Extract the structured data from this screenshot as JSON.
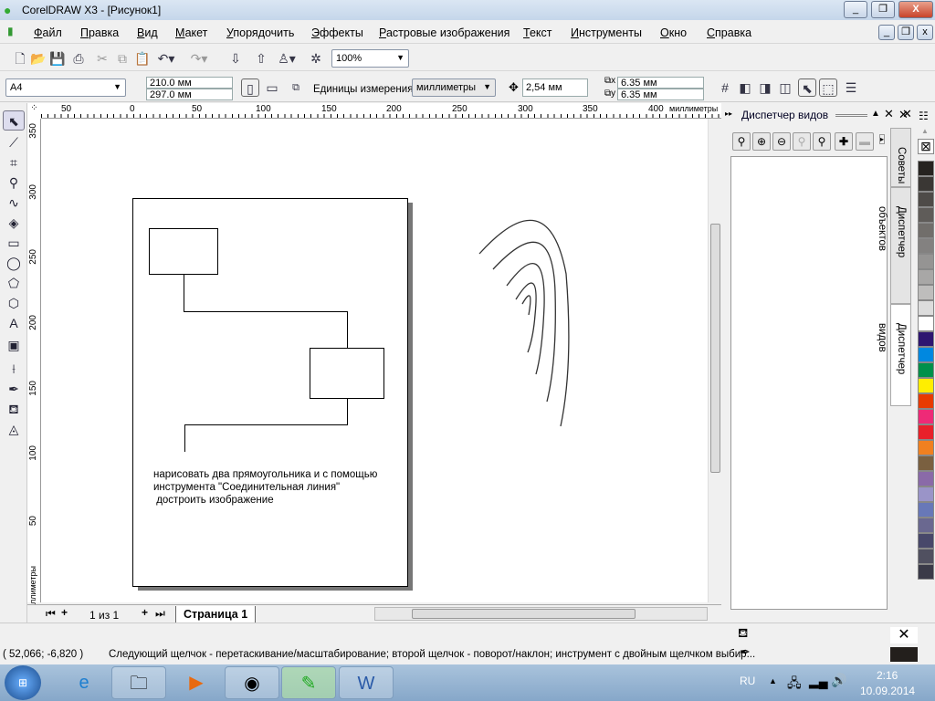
{
  "window": {
    "title": "CorelDRAW X3 - [Рисунок1]",
    "minimize": "_",
    "maximize": "❐",
    "close": "X"
  },
  "menu": [
    "Файл",
    "Правка",
    "Вид",
    "Макет",
    "Упорядочить",
    "Эффекты",
    "Растровые изображения",
    "Текст",
    "Инструменты",
    "Окно",
    "Справка"
  ],
  "toolbar": {
    "zoom": "100%"
  },
  "propbar": {
    "page_size": "A4",
    "width": "210.0 мм",
    "height": "297.0 мм",
    "units_label": "Единицы измерения:",
    "units": "миллиметры",
    "nudge": "2,54 мм",
    "dup_x": "6.35 мм",
    "dup_y": "6.35 мм"
  },
  "ruler": {
    "h_ticks": [
      "50",
      "0",
      "50",
      "100",
      "150",
      "200",
      "250",
      "300",
      "350",
      "400"
    ],
    "h_unit": "миллиметры",
    "v_ticks": [
      "350",
      "300",
      "250",
      "200",
      "150",
      "100",
      "50"
    ],
    "v_unit": "миллиметры"
  },
  "canvas": {
    "note_lines": [
      "нарисовать два прямоугольника и с помощью",
      "инструмента \"Соединительная линия\"",
      " достроить изображение"
    ]
  },
  "pagebar": {
    "count": "1 из 1",
    "tab": "Страница 1"
  },
  "docker": {
    "title": "Диспетчер видов",
    "tabs": [
      "Советы",
      "Диспетчер объектов",
      "Диспетчер видов"
    ]
  },
  "palette": [
    "#262320",
    "#3a3734",
    "#4e4b48",
    "#5f5c59",
    "#716e6b",
    "#838180",
    "#959493",
    "#a8a7a6",
    "#bebdbc",
    "#dcdcdc",
    "#ffffff",
    "#2e1670",
    "#0088e0",
    "#00904a",
    "#ffee00",
    "#e83a00",
    "#ee2a77",
    "#e8202a",
    "#f08020",
    "#7a6040",
    "#8a6aa8",
    "#9a94c8",
    "#6878b8",
    "#6a6890",
    "#48486a",
    "#505060",
    "#3a3a48"
  ],
  "status": {
    "coords": "( 52,066; -6,820 )",
    "hint": "Следующий щелчок - перетаскивание/масштабирование; второй щелчок - поворот/наклон; инструмент с двойным щелчком выбир..."
  },
  "taskbar": {
    "lang": "RU",
    "time": "2:16",
    "date": "10.09.2014"
  }
}
